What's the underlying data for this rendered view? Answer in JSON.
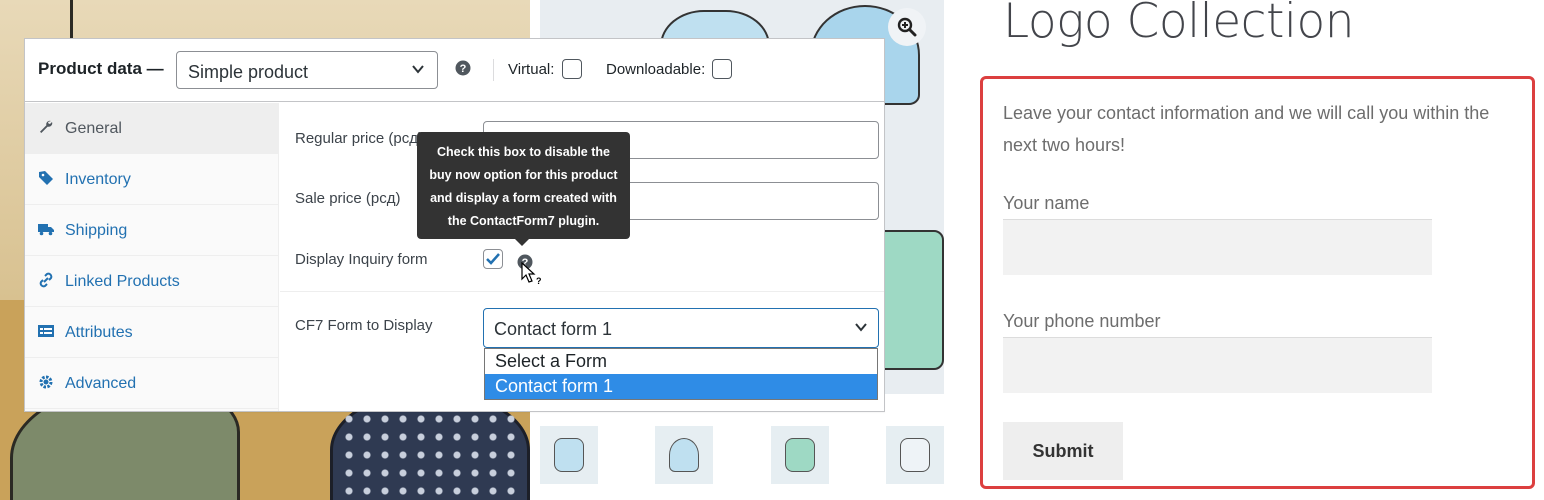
{
  "product_panel": {
    "title": "Product data —",
    "product_type": "Simple product",
    "virtual_label": "Virtual:",
    "downloadable_label": "Downloadable:",
    "virtual_checked": false,
    "downloadable_checked": false
  },
  "tabs": [
    {
      "label": "General",
      "icon": "wrench-icon",
      "active": true
    },
    {
      "label": "Inventory",
      "icon": "tag-icon",
      "active": false
    },
    {
      "label": "Shipping",
      "icon": "truck-icon",
      "active": false
    },
    {
      "label": "Linked Products",
      "icon": "link-icon",
      "active": false
    },
    {
      "label": "Attributes",
      "icon": "list-icon",
      "active": false
    },
    {
      "label": "Advanced",
      "icon": "gear-icon",
      "active": false
    }
  ],
  "general": {
    "regular_price_label": "Regular price (рсд)",
    "regular_price_value": "",
    "sale_price_label": "Sale price (рсд)",
    "sale_price_value": "",
    "inquiry_label": "Display Inquiry form",
    "inquiry_checked": true,
    "cf7_label": "CF7 Form to Display",
    "cf7_selected": "Contact form 1",
    "cf7_options": [
      "Select a Form",
      "Contact form 1"
    ]
  },
  "tooltip": {
    "lines": [
      "Check this box to disable the",
      "buy now option for this product",
      "and display a form created with",
      "the ContactForm7 plugin."
    ]
  },
  "storefront": {
    "title": "Logo Collection",
    "intro": "Leave your contact information and we will call you within the next two hours!",
    "name_label": "Your name",
    "phone_label": "Your phone number",
    "submit_label": "Submit",
    "highlight_color": "#dc3f3f"
  },
  "colors": {
    "accent": "#2271b1",
    "dropdown_selected": "#2f8ce6",
    "tooltip_bg": "#333333"
  }
}
